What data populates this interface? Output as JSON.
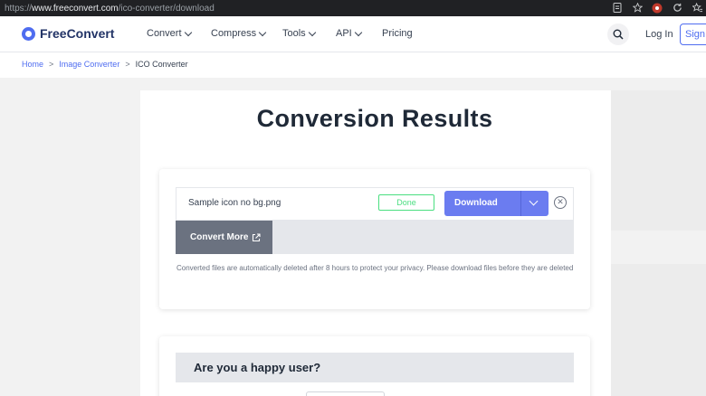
{
  "browser": {
    "url_prefix": "https://",
    "url_host": "www.freeconvert.com",
    "url_path": "/ico-converter/download"
  },
  "header": {
    "brand": "FreeConvert",
    "nav": [
      {
        "label": "Convert"
      },
      {
        "label": "Compress"
      },
      {
        "label": "Tools"
      },
      {
        "label": "API"
      },
      {
        "label": "Pricing"
      }
    ],
    "login": "Log In",
    "signup": "Sign Up"
  },
  "breadcrumb": [
    "Home",
    "Image Converter",
    "ICO Converter"
  ],
  "page": {
    "title": "Conversion Results"
  },
  "result": {
    "file_name": "Sample icon no bg.png",
    "status": "Done",
    "download_label": "Download",
    "convert_more_label": "Convert More",
    "note": "Converted files are automatically deleted after 8 hours to protect your privacy. Please download files before they are deleted"
  },
  "feedback": {
    "question": "Are you a happy user?"
  },
  "colors": {
    "brand": "#4f6df0",
    "download_button": "#6b7cf0",
    "done": "#4ade80",
    "convert_more": "#6b7280"
  }
}
